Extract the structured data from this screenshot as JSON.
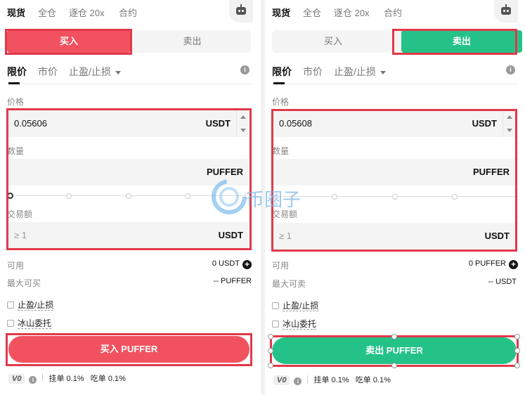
{
  "nav_tabs": [
    "现货",
    "全仓",
    "逐仓 20x",
    "合约"
  ],
  "side_tabs": {
    "buy": "买入",
    "sell": "卖出"
  },
  "order_types": {
    "limit": "限价",
    "market": "市价",
    "tpsl": "止盈/止损"
  },
  "labels": {
    "price": "价格",
    "amount": "数量",
    "total": "交易额",
    "available": "可用"
  },
  "units": {
    "quote": "USDT",
    "base": "PUFFER"
  },
  "left": {
    "price": "0.05606",
    "total_placeholder": "≥ 1",
    "available": "0 USDT",
    "max_label": "最大可买",
    "max_value": "-- PUFFER",
    "submit": "买入 PUFFER"
  },
  "right": {
    "price": "0.05608",
    "total_placeholder": "≥ 1",
    "available": "0 PUFFER",
    "max_label": "最大可卖",
    "max_value": "-- USDT",
    "submit": "卖出 PUFFER"
  },
  "options": {
    "tpsl": "止盈/止损",
    "iceberg": "冰山委托"
  },
  "fees": {
    "vip": "V0",
    "maker": "挂单 0.1%",
    "taker": "吃单 0.1%"
  },
  "watermark": "币圈子",
  "colors": {
    "buy": "#f2525f",
    "sell": "#25c288",
    "highlight": "#e0394a"
  },
  "icons": [
    "robot-icon",
    "info-icon",
    "plus-icon",
    "chevron-down-icon"
  ]
}
